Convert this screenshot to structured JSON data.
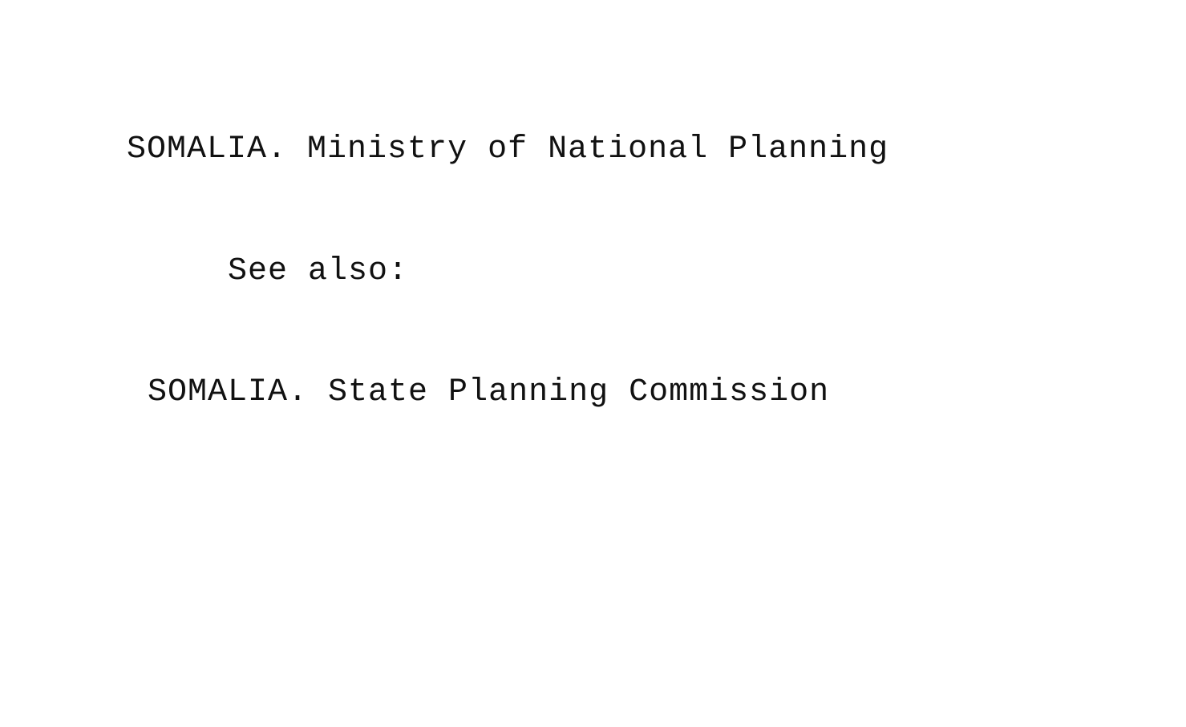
{
  "card": {
    "heading": "SOMALIA. Ministry of National Planning",
    "see_also_label": "See also:",
    "references": [
      "SOMALIA. State Planning Commission"
    ]
  }
}
